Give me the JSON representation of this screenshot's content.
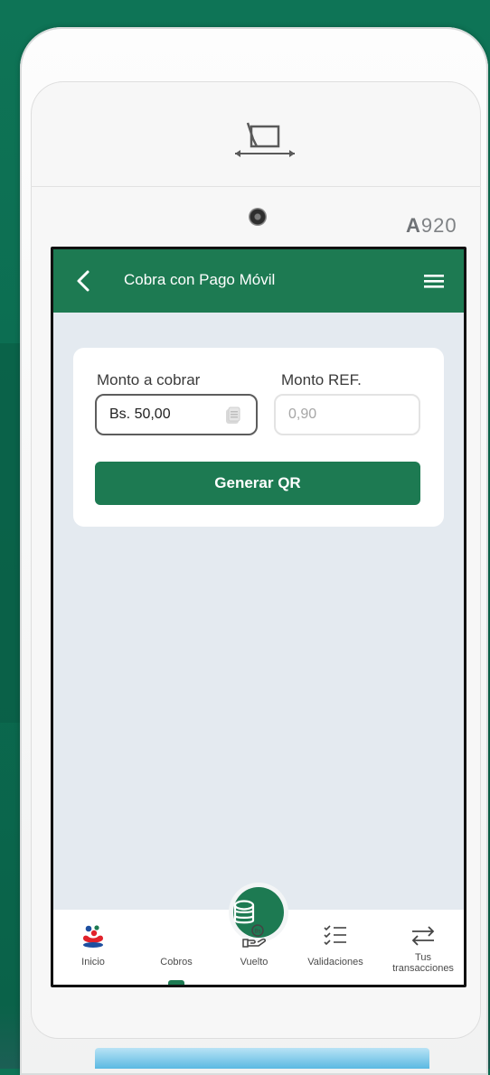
{
  "device": {
    "model_prefix": "A",
    "model_number": "920"
  },
  "header": {
    "title": "Cobra con Pago Móvil",
    "back_icon": "chevron-left-icon",
    "menu_icon": "hamburger-menu-icon"
  },
  "form": {
    "monto_label": "Monto a cobrar",
    "monto_value": "Bs. 50,00",
    "ref_label": "Monto REF.",
    "ref_value": "0,90",
    "button_label": "Generar QR"
  },
  "nav": {
    "items": [
      {
        "label": "Inicio",
        "icon": "home-people-icon"
      },
      {
        "label": "Cobros",
        "icon": "coins-icon"
      },
      {
        "label": "Vuelto",
        "icon": "hand-coin-icon"
      },
      {
        "label": "Validaciones",
        "icon": "checklist-icon"
      },
      {
        "label": "Tus transacciones",
        "icon": "transfer-arrows-icon"
      }
    ],
    "active": "Cobros"
  },
  "colors": {
    "brand_green": "#1d7a52",
    "screen_bg": "#e4eaf0",
    "accent_red": "#e1222b",
    "accent_blue": "#1d4fa0"
  }
}
